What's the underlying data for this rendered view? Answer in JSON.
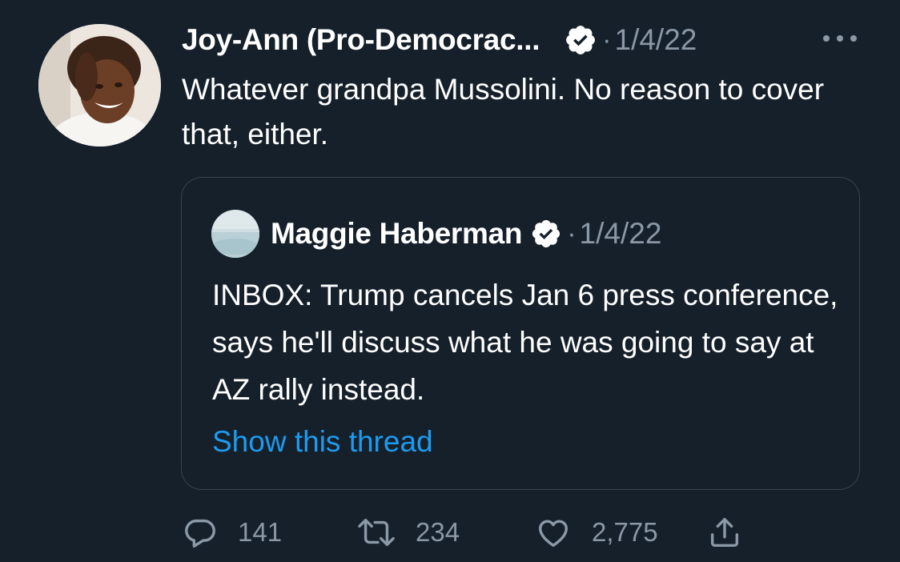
{
  "tweet": {
    "author_name": "Joy-Ann (Pro-Democrac...",
    "separator": "·",
    "date": "1/4/22",
    "text": "Whatever grandpa Mussolini. No reason to cover that, either.",
    "avatar_icon": "profile-photo",
    "verified_icon": "verified-badge-icon",
    "more_icon": "more-horizontal-icon"
  },
  "quote": {
    "author_name": "Maggie Haberman",
    "separator": "·",
    "date": "1/4/22",
    "text": "INBOX: Trump cancels Jan 6 press conference, says he'll discuss what he was going to say at AZ rally instead.",
    "link_text": "Show this thread",
    "avatar_icon": "profile-photo"
  },
  "actions": {
    "reply_count": "141",
    "retweet_count": "234",
    "like_count": "2,775",
    "reply_icon": "reply-icon",
    "retweet_icon": "retweet-icon",
    "like_icon": "heart-icon",
    "share_icon": "share-icon"
  },
  "colors": {
    "background": "#15202b",
    "text_primary": "#ffffff",
    "text_secondary": "#8b98a5",
    "border": "#38444d",
    "link": "#1d9bf0"
  }
}
